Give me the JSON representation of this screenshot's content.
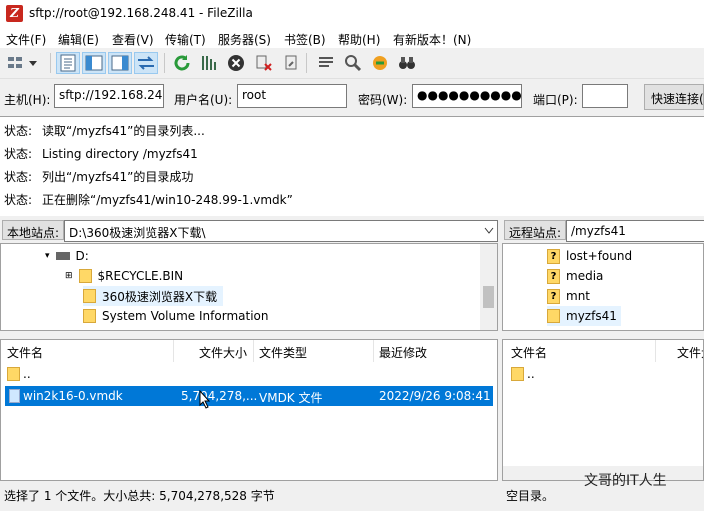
{
  "window": {
    "title": "sftp://root@192.168.248.41 - FileZilla"
  },
  "menu": [
    {
      "label": "文件(F)"
    },
    {
      "label": "编辑(E)"
    },
    {
      "label": "查看(V)"
    },
    {
      "label": "传输(T)"
    },
    {
      "label": "服务器(S)"
    },
    {
      "label": "书签(B)"
    },
    {
      "label": "帮助(H)"
    },
    {
      "label": "有新版本！(N)"
    }
  ],
  "quickconnect": {
    "host_label": "主机(H):",
    "host_value": "sftp://192.168.248",
    "user_label": "用户名(U):",
    "user_value": "root",
    "pass_label": "密码(W):",
    "pass_value": "●●●●●●●●●●●",
    "port_label": "端口(P):",
    "port_value": "",
    "connect_label": "快速连接("
  },
  "log": [
    {
      "label": "状态:",
      "text": "读取“/myzfs41”的目录列表..."
    },
    {
      "label": "状态:",
      "text": "Listing directory /myzfs41"
    },
    {
      "label": "状态:",
      "text": "列出“/myzfs41”的目录成功"
    },
    {
      "label": "状态:",
      "text": "正在删除“/myzfs41/win10-248.99-1.vmdk”"
    }
  ],
  "local": {
    "site_label": "本地站点:",
    "site_path": "D:\\360极速浏览器X下载\\",
    "tree": [
      {
        "label": "D:"
      },
      {
        "label": "$RECYCLE.BIN"
      },
      {
        "label": "360极速浏览器X下载"
      },
      {
        "label": "System Volume Information"
      }
    ],
    "columns": [
      "文件名",
      "文件大小",
      "文件类型",
      "最近修改"
    ],
    "files": [
      {
        "name": "..",
        "size": "",
        "type": "",
        "modified": ""
      },
      {
        "name": "win2k16-0.vmdk",
        "size": "5,704,278,...",
        "type": "VMDK 文件",
        "modified": "2022/9/26 9:08:41"
      }
    ],
    "status": "选择了 1 个文件。大小总共: 5,704,278,528 字节"
  },
  "remote": {
    "site_label": "远程站点:",
    "site_path": "/myzfs41",
    "tree": [
      {
        "label": "lost+found"
      },
      {
        "label": "media"
      },
      {
        "label": "mnt"
      },
      {
        "label": "myzfs41"
      }
    ],
    "columns": [
      "文件名",
      "文件大"
    ],
    "files": [
      {
        "name": ".."
      }
    ],
    "status": "空目录。"
  },
  "watermark": "文哥的IT人生",
  "colors": {
    "selection": "#0078d7",
    "folder": "#ffd866"
  }
}
